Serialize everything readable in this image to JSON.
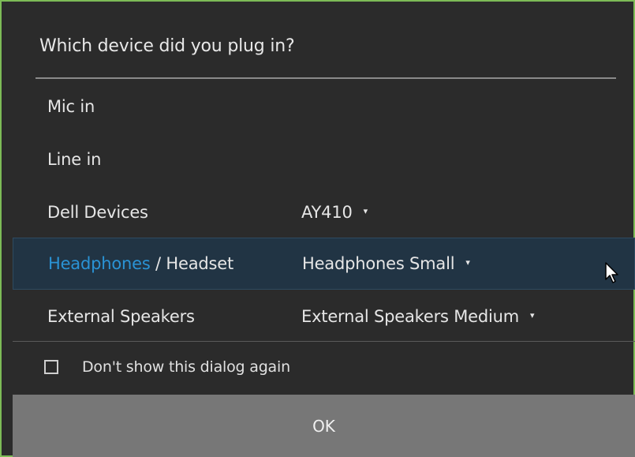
{
  "dialog": {
    "title": "Which device did you plug in?",
    "rows": [
      {
        "label": "Mic in"
      },
      {
        "label": "Line in"
      },
      {
        "label": "Dell Devices",
        "dropdown": "AY410"
      },
      {
        "label_accent": "Headphones",
        "label_rest": " / Headset",
        "dropdown": "Headphones Small"
      },
      {
        "label": "External Speakers",
        "dropdown": "External Speakers Medium"
      }
    ],
    "checkbox_label": "Don't show this dialog again",
    "ok_label": "OK"
  },
  "icons": {
    "dropdown_caret": "caret-down-icon",
    "checkbox": "checkbox-unchecked-icon",
    "cursor": "mouse-pointer-icon"
  },
  "colors": {
    "border": "#7dbb57",
    "background": "#2b2b2b",
    "accent": "#2a93d5",
    "selected_row": "#213444",
    "footer": "#777777"
  }
}
